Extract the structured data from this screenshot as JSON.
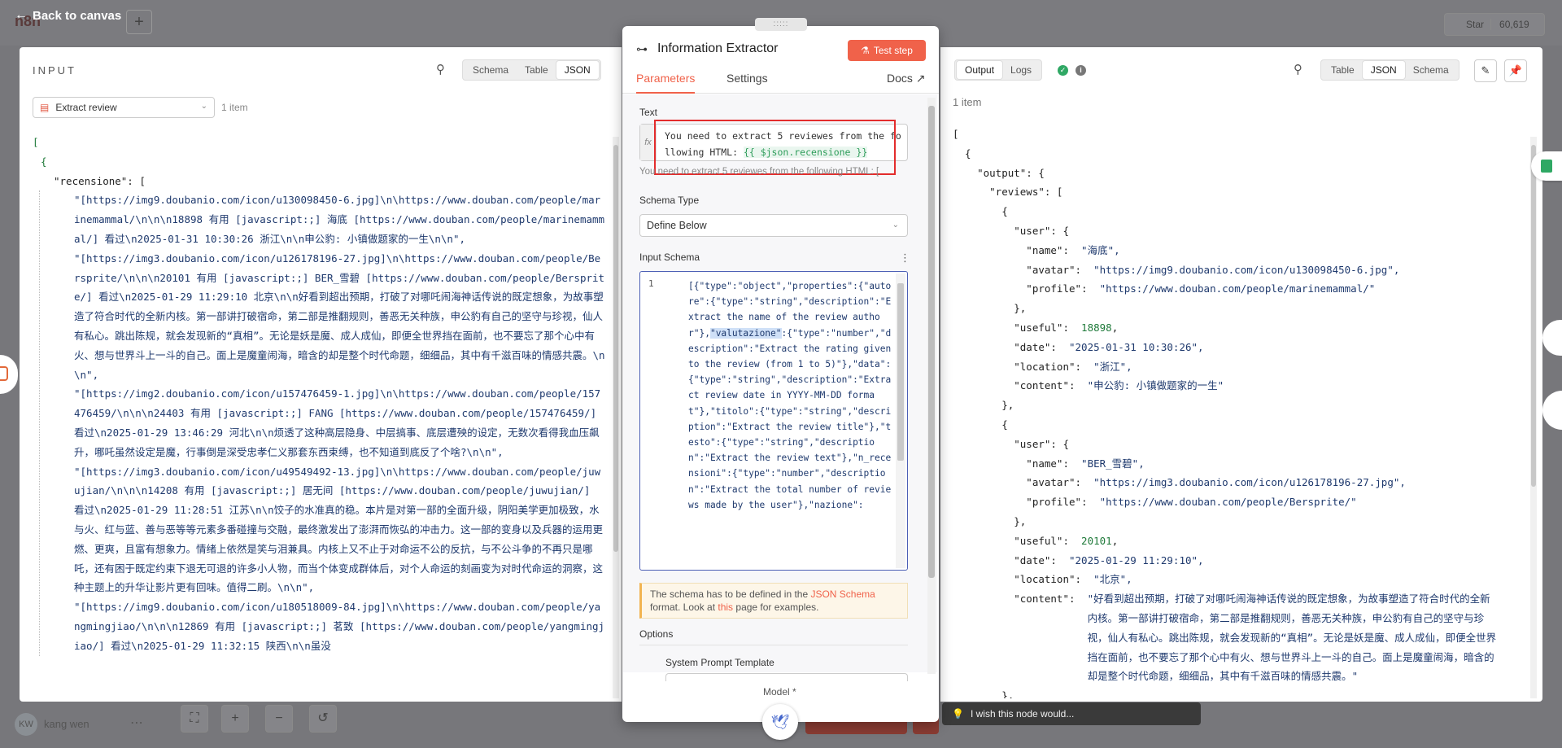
{
  "canvas": {
    "back_label": "Back to canvas",
    "logo": "n8n",
    "plus": "+",
    "star_label": "Star",
    "star_count": "60,619",
    "user_initials": "KW",
    "user_name": "kang wen",
    "wish_text": "I wish this node would..."
  },
  "input_panel": {
    "title": "INPUT",
    "view_tabs": [
      "Schema",
      "Table",
      "JSON"
    ],
    "active_view": "JSON",
    "node_select": "Extract review",
    "item_count": "1 item",
    "json_open_bracket": "[",
    "json_open_brace": "{",
    "json_key": "\"recensione\": [",
    "json_strings": [
      "\"[https://img9.doubanio.com/icon/u130098450-6.jpg]\\n\\https://www.douban.com/people/marinemammal/\\n\\n\\n18898 有用 [javascript:;] 海底 [https://www.douban.com/people/marinemammal/] 看过\\n2025-01-31 10:30:26 浙江\\n\\n申公豹: 小镇做题家的一生\\n\\n\",",
      "\"[https://img3.doubanio.com/icon/u126178196-27.jpg]\\n\\https://www.douban.com/people/Bersprite/\\n\\n\\n20101 有用 [javascript:;] BER_雪碧 [https://www.douban.com/people/Bersprite/] 看过\\n2025-01-29 11:29:10 北京\\n\\n好看到超出预期，打破了对哪吒闹海神话传说的既定想象，为故事塑造了符合时代的全新内核。第一部讲打破宿命，第二部是推翻规则，善恶无关种族，申公豹有自己的坚守与珍视，仙人有私心。跳出陈规，就会发现新的“真相”。无论是妖是魔、成人成仙，即便全世界挡在面前，也不要忘了那个心中有火、想与世界斗上一斗的自己。面上是魔童闹海，暗含的却是整个时代命题，细细品，其中有千滋百味的情感共震。\\n\\n\",",
      "\"[https://img2.doubanio.com/icon/u157476459-1.jpg]\\n\\https://www.douban.com/people/157476459/\\n\\n\\n24403 有用 [javascript:;] FANG [https://www.douban.com/people/157476459/] 看过\\n2025-01-29 13:46:29 河北\\n\\n烦透了这种高层隐身、中层搞事、底层遭殃的设定，无数次看得我血压飙升，哪吒虽然设定是魔，行事倒是深受忠孝仁义那套东西束缚，也不知道到底反了个啥?\\n\\n\",",
      "\"[https://img3.doubanio.com/icon/u49549492-13.jpg]\\n\\https://www.douban.com/people/juwujian/\\n\\n\\n14208 有用 [javascript:;] 居无间 [https://www.douban.com/people/juwujian/] 看过\\n2025-01-29 11:28:51 江苏\\n\\n饺子的水准真的稳。本片是对第一部的全面升级，阴阳美学更加极致，水与火、红与蓝、善与恶等等元素多番碰撞与交融，最终激发出了澎湃而恢弘的冲击力。这一部的变身以及兵器的运用更燃、更爽，且富有想象力。情绪上依然是笑与泪兼具。内核上又不止于对命运不公的反抗，与不公斗争的不再只是哪吒，还有困于既定约束下退无可退的许多小人物，而当个体变成群体后，对个人命运的刻画变为对时代命运的洞察，这种主题上的升华让影片更有回味。值得二刷。\\n\\n\",",
      "\"[https://img9.doubanio.com/icon/u180518009-84.jpg]\\n\\https://www.douban.com/people/yangmingjiao/\\n\\n\\n12869 有用 [javascript:;] 茗致 [https://www.douban.com/people/yangmingjiao/] 看过\\n2025-01-29 11:32:15 陕西\\n\\n虽没"
    ]
  },
  "modal": {
    "handle": ":::::",
    "title": "Information Extractor",
    "test_button": "Test step",
    "tabs": [
      "Parameters",
      "Settings"
    ],
    "active_tab": "Parameters",
    "docs": "Docs",
    "text_label": "Text",
    "fx": "fx",
    "text_value_prefix": "You need to extract 5 reviewes from the following HTML: ",
    "text_expression": "{{ $json.recensione }}",
    "text_preview": "You need to extract 5 reviewes from the following HTML: [",
    "schema_type_label": "Schema Type",
    "schema_type_value": "Define Below",
    "input_schema_label": "Input Schema",
    "code_line_number": "1",
    "code_parts": [
      "[{\"type\":\"object\",\"properties\":{\"autore\":{\"type\":\"string\",\"description\":\"Extract the name of the review author\"},",
      "\"valutazione\"",
      ":{\"type\":\"number\",\"description\":\"Extract the rating given to the review (from 1 to 5)\"},\"data\":{\"type\":\"string\",\"description\":\"Extract review date in YYYY-MM-DD format\"},\"titolo\":{\"type\":\"string\",\"description\":\"Extract the review title\"},\"testo\":{\"type\":\"string\",\"description\":\"Extract the review text\"},\"n_recensioni\":{\"type\":\"number\",\"description\":\"Extract the total number of reviews made by the user\"},\"nazione\":"
    ],
    "note_prefix": "The schema has to be defined in the ",
    "note_link1": "JSON Schema",
    "note_mid": " format. Look at ",
    "note_link2": "this",
    "note_suffix": " page for examples.",
    "options_label": "Options",
    "system_prompt_label": "System Prompt Template",
    "model_label": "Model",
    "model_required": "*"
  },
  "output_panel": {
    "tabs": [
      "Output",
      "Logs"
    ],
    "active_tab": "Output",
    "view_tabs": [
      "Table",
      "JSON",
      "Schema"
    ],
    "active_view": "JSON",
    "item_count": "1 item",
    "reviews": [
      {
        "name": "\"海底\",",
        "avatar": "\"https://img9.doubanio.com/icon/u130098450-6.jpg\",",
        "profile": "\"https://www.douban.com/people/marinemammal/\"",
        "useful": "18898",
        "date": "\"2025-01-31 10:30:26\",",
        "location": "\"浙江\",",
        "content": "\"申公豹: 小镇做题家的一生\""
      },
      {
        "name": "\"BER_雪碧\",",
        "avatar": "\"https://img3.doubanio.com/icon/u126178196-27.jpg\",",
        "profile": "\"https://www.douban.com/people/Bersprite/\"",
        "useful": "20101",
        "date": "\"2025-01-29 11:29:10\",",
        "location": "\"北京\",",
        "content": "\"好看到超出预期，打破了对哪吒闹海神话传说的既定想象，为故事塑造了符合时代的全新内核。第一部讲打破宿命，第二部是推翻规则，善恶无关种族，申公豹有自己的坚守与珍视，仙人有私心。跳出陈规，就会发现新的“真相”。无论是妖是魔、成人成仙，即便全世界挡在面前，也不要忘了那个心中有火、想与世界斗上一斗的自己。面上是魔童闹海，暗含的却是整个时代命题，细细品，其中有千滋百味的情感共震。\""
      }
    ]
  },
  "colors": {
    "accent": "#f0624a",
    "success": "#2fa864",
    "highlight": "#e32c2c",
    "selection": "#4c5fb5"
  }
}
